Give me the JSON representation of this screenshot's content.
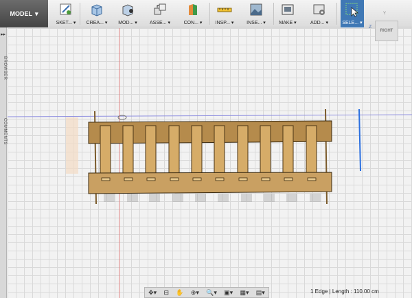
{
  "toolbar": {
    "workspace": "MODEL",
    "workspace_arrow": "▾",
    "tools": [
      {
        "label": "SKET... ▾",
        "icon": "sketch-icon"
      },
      {
        "label": "CREA... ▾",
        "icon": "create-box-icon"
      },
      {
        "label": "MOD... ▾",
        "icon": "modify-icon"
      },
      {
        "label": "ASSE... ▾",
        "icon": "assemble-icon"
      },
      {
        "label": "CON... ▾",
        "icon": "construct-icon"
      },
      {
        "label": "INSP... ▾",
        "icon": "inspect-measure-icon"
      },
      {
        "label": "INSE... ▾",
        "icon": "insert-image-icon"
      },
      {
        "label": "MAKE ▾",
        "icon": "make-3dprint-icon"
      },
      {
        "label": "ADD... ▾",
        "icon": "addins-icon"
      },
      {
        "label": "SELE... ▾",
        "icon": "select-cursor-icon"
      }
    ]
  },
  "sidepanel": {
    "collapse": "▸▸",
    "tabs": [
      "BROWSER",
      "COMMENTS"
    ]
  },
  "viewcube": {
    "face": "RIGHT",
    "axis_z": "Z",
    "axis_y": "Y"
  },
  "navbar": {
    "items": [
      "✥▾",
      "⊟",
      "✋",
      "⊕▾",
      "🔍▾",
      "▣▾",
      "▦▾",
      "▤▾"
    ]
  },
  "status": {
    "text": "1 Edge | Length : 110.00 cm"
  }
}
